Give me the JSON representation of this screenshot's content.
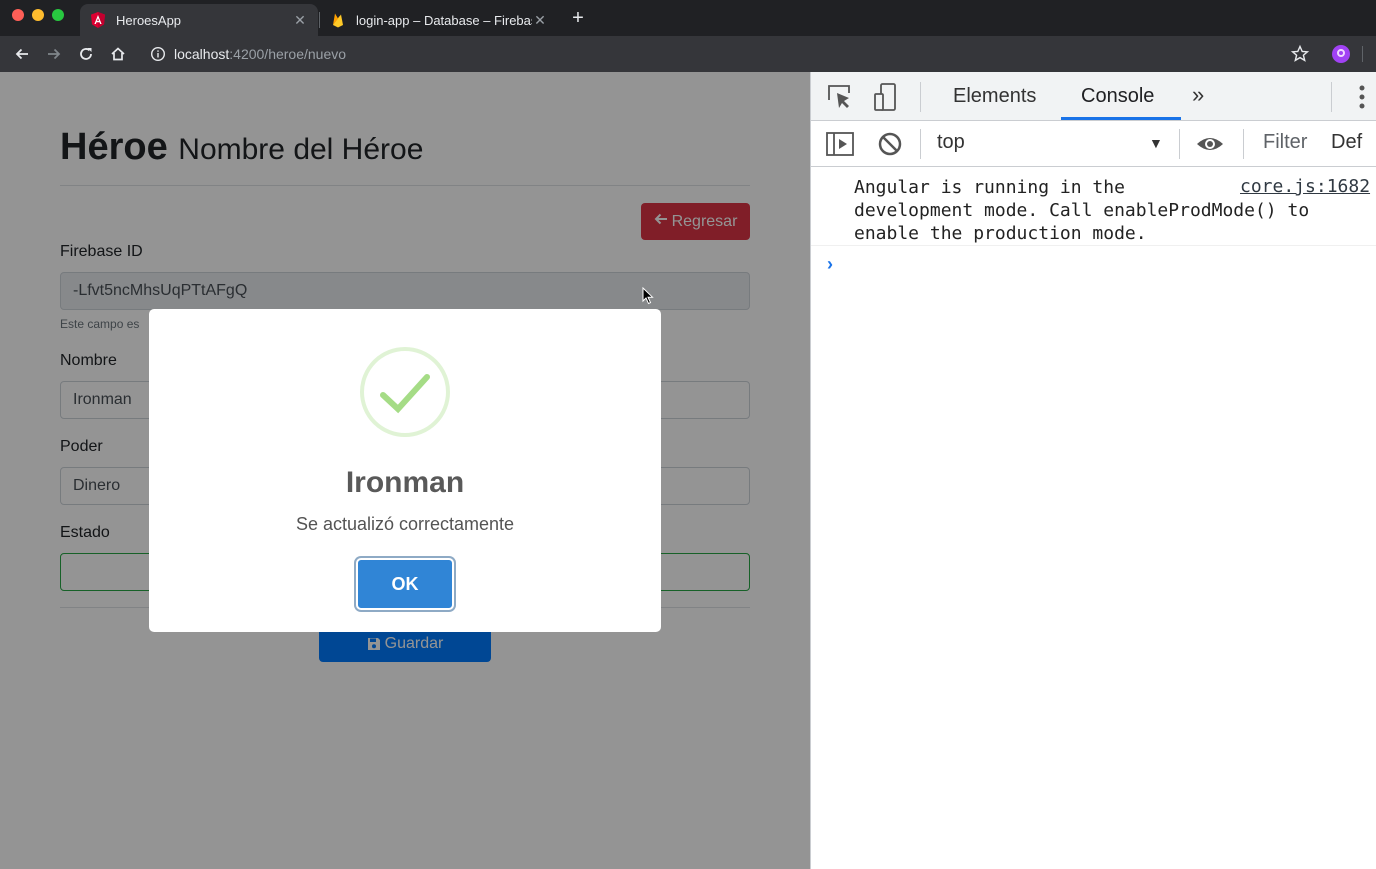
{
  "browser": {
    "tabs": [
      {
        "title": "HeroesApp",
        "active": true
      },
      {
        "title": "login-app – Database – Firebase",
        "active": false
      }
    ],
    "url_host": "localhost",
    "url_path": ":4200/heroe/nuevo"
  },
  "page": {
    "title": "Héroe",
    "subtitle": "Nombre del Héroe",
    "back_button": "Regresar",
    "firebase_label": "Firebase ID",
    "firebase_value": "-Lfvt5ncMhsUqPTtAFgQ",
    "firebase_help": "Este campo es",
    "nombre_label": "Nombre",
    "nombre_value": "Ironman",
    "poder_label": "Poder",
    "poder_value": "Dinero",
    "estado_label": "Estado",
    "save_button": "Guardar"
  },
  "modal": {
    "title": "Ironman",
    "text": "Se actualizó correctamente",
    "ok_button": "OK"
  },
  "devtools": {
    "tabs": [
      "Elements",
      "Console"
    ],
    "active_tab": "Console",
    "context": "top",
    "filter_placeholder": "Filter",
    "levels": "Def",
    "log_message": "Angular is running in the\ndevelopment mode. Call enableProdMode() to\nenable the production mode.",
    "log_source": "core.js:1682"
  },
  "colors": {
    "danger": "#dc3545",
    "primary": "#007bff",
    "swal_confirm": "#3085d6",
    "success_icon": "#a5dc86",
    "devtools_accent": "#1a73e8"
  }
}
